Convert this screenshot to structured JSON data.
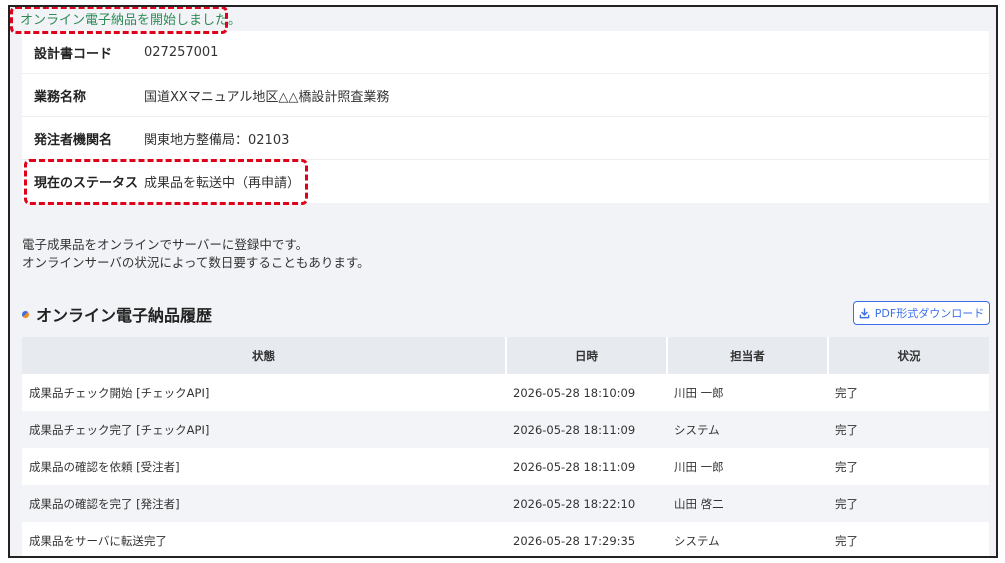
{
  "notice": "オンライン電子納品を開始しました。",
  "info": {
    "rows": [
      {
        "label": "設計書コード",
        "value": "027257001"
      },
      {
        "label": "業務名称",
        "value": "国道XXマニュアル地区△△橋設計照査業務"
      },
      {
        "label": "発注者機関名",
        "value": "関東地方整備局：02103"
      },
      {
        "label": "現在のステータス",
        "value": "成果品を転送中（再申請）"
      }
    ]
  },
  "description": {
    "line1": "電子成果品をオンラインでサーバーに登録中です。",
    "line2": "オンラインサーバの状況によって数日要することもあります。"
  },
  "history": {
    "title": "オンライン電子納品履歴",
    "download_label": "PDF形式ダウンロード",
    "columns": [
      "状態",
      "日時",
      "担当者",
      "状況"
    ],
    "rows": [
      [
        "成果品チェック開始 [チェックAPI]",
        "2026-05-28 18:10:09",
        "川田 一郎",
        "完了"
      ],
      [
        "成果品チェック完了 [チェックAPI]",
        "2026-05-28 18:11:09",
        "システム",
        "完了"
      ],
      [
        "成果品の確認を依頼 [受注者]",
        "2026-05-28 18:11:09",
        "川田 一郎",
        "完了"
      ],
      [
        "成果品の確認を完了 [発注者]",
        "2026-05-28 18:22:10",
        "山田 啓二",
        "完了"
      ],
      [
        "成果品をサーバに転送完了",
        "2026-05-28 17:29:35",
        "システム",
        "完了"
      ]
    ]
  },
  "colors": {
    "accent": "#3a6ee8",
    "notice": "#2e8b57",
    "highlight": "#e0001a"
  }
}
